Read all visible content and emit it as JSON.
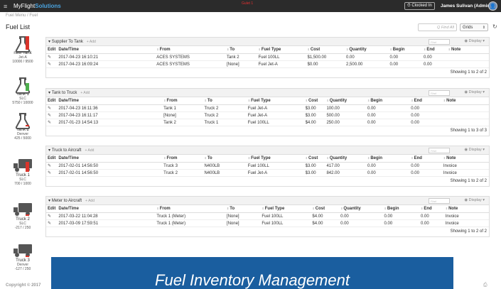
{
  "topbar": {
    "menu_icon": "hamburger-icon",
    "brand_prefix": "MyFlight",
    "brand_suffix": "Solutions",
    "center_text": "Gulet 1",
    "clock_label": "⏱ Clocked In",
    "user": "James Sulivan (Admin)"
  },
  "breadcrumb": "Fuel Menu  /  Fuel",
  "page_title": "Fuel List",
  "toolbar": {
    "find_placeholder": "Q Find All",
    "view_select": "Grids",
    "refresh_icon": "refresh-icon"
  },
  "tanks": [
    {
      "name": "new Tank",
      "sub": "Jet-A",
      "cap": "10000 / 9500",
      "type": "flask",
      "color": "#d9342b",
      "fill": 0.95
    },
    {
      "name": "Tank 1",
      "sub": "SLC",
      "cap": "5750 / 10000",
      "type": "flask",
      "color": "#4cae4c",
      "fill": 0.57
    },
    {
      "name": "Tank 2",
      "sub": "Denver",
      "cap": "425 / 5000",
      "type": "flask",
      "color": "#d9342b",
      "fill": 0.08
    },
    {
      "name": "Truck 1",
      "sub": "SLC",
      "cap": "700 / 1000",
      "type": "truck",
      "color": "#d9342b",
      "fill": 0.7
    },
    {
      "name": "Truck 2",
      "sub": "SLC",
      "cap": "-217 / 250",
      "type": "truck",
      "color": "#d9342b",
      "fill": 0.05
    },
    {
      "name": "Truck 3",
      "sub": "Denver",
      "cap": "-127 / 250",
      "type": "truck",
      "color": "#d9342b",
      "fill": 0.05
    }
  ],
  "sections": [
    {
      "title": "Supplier To Tank",
      "add": "+ Add",
      "find": "Find",
      "display": "◉ Display ▾",
      "headers": [
        "Edit",
        "Date/Time",
        "From",
        "To",
        "Fuel Type",
        "Cost",
        "Quantity",
        "Begin",
        "End",
        "Note"
      ],
      "rows": [
        [
          "2017-04-23 16:10:21",
          "ACES SYSTEMS",
          "Tank 2",
          "Fuel 100LL",
          "$1,500.00",
          "0.00",
          "0.00",
          "0.00",
          ""
        ],
        [
          "2017-04-23 16:09:24",
          "ACES SYSTEMS",
          "[None]",
          "Fuel Jet-A",
          "$0.00",
          "2,500.00",
          "0.00",
          "0.00",
          ""
        ]
      ],
      "showing": "Showing 1 to 2 of 2"
    },
    {
      "title": "Tank to Truck",
      "add": "+ Add",
      "find": "Find",
      "display": "◉ Display ▾",
      "headers": [
        "Edit",
        "Date/Time",
        "From",
        "To",
        "Fuel Type",
        "Cost",
        "Quantity",
        "Begin",
        "End",
        "Note"
      ],
      "rows": [
        [
          "2017-04-23 16:11:36",
          "Tank 1",
          "Truck 2",
          "Fuel Jet-A",
          "$3.00",
          "100.00",
          "0.00",
          "0.00",
          ""
        ],
        [
          "2017-04-23 16:11:17",
          "[None]",
          "Truck 2",
          "Fuel Jet-A",
          "$3.00",
          "500.00",
          "0.00",
          "0.00",
          ""
        ],
        [
          "2017-01-23 14:54:13",
          "Tank 2",
          "Truck 1",
          "Fuel 100LL",
          "$4.00",
          "250.00",
          "0.00",
          "0.00",
          ""
        ]
      ],
      "showing": "Showing 1 to 3 of 3"
    },
    {
      "title": "Truck to Aircraft",
      "add": "+ Add",
      "find": "Find",
      "display": "◉ Display ▾",
      "headers": [
        "Edit",
        "Date/Time",
        "From",
        "To",
        "Fuel Type",
        "Cost",
        "Quantity",
        "Begin",
        "End",
        "Note"
      ],
      "rows": [
        [
          "2017-02-01 14:56:50",
          "Truck 3",
          "N400LB",
          "Fuel 100LL",
          "$3.00",
          "417.00",
          "0.00",
          "0.00",
          "Invoice"
        ],
        [
          "2017-02-01 14:56:50",
          "Truck 2",
          "N400LB",
          "Fuel Jet-A",
          "$3.00",
          "842.00",
          "0.00",
          "0.00",
          "Invoice"
        ]
      ],
      "showing": "Showing 1 to 2 of 2"
    },
    {
      "title": "Meter to Aircraft",
      "add": "+ Add",
      "find": "Find",
      "display": "◉ Display ▾",
      "headers": [
        "Edit",
        "Date/Time",
        "From",
        "To",
        "Fuel Type",
        "Cost",
        "Quantity",
        "Begin",
        "End",
        "Note"
      ],
      "rows": [
        [
          "2017-03-22 11:04:28",
          "Truck 1 (Meter)",
          "[None]",
          "Fuel 100LL",
          "$4.00",
          "0.00",
          "0.00",
          "0.00",
          "Invoice"
        ],
        [
          "2017-03-09 17:59:51",
          "Truck 1 (Meter)",
          "[None]",
          "Fuel 100LL",
          "$4.00",
          "0.00",
          "0.00",
          "0.00",
          "Invoice"
        ]
      ],
      "showing": "Showing 1 to 2 of 2"
    }
  ],
  "overlay_text": "Fuel Inventory Management",
  "copyright": "Copyright © 2017",
  "print_icon": "print-icon"
}
